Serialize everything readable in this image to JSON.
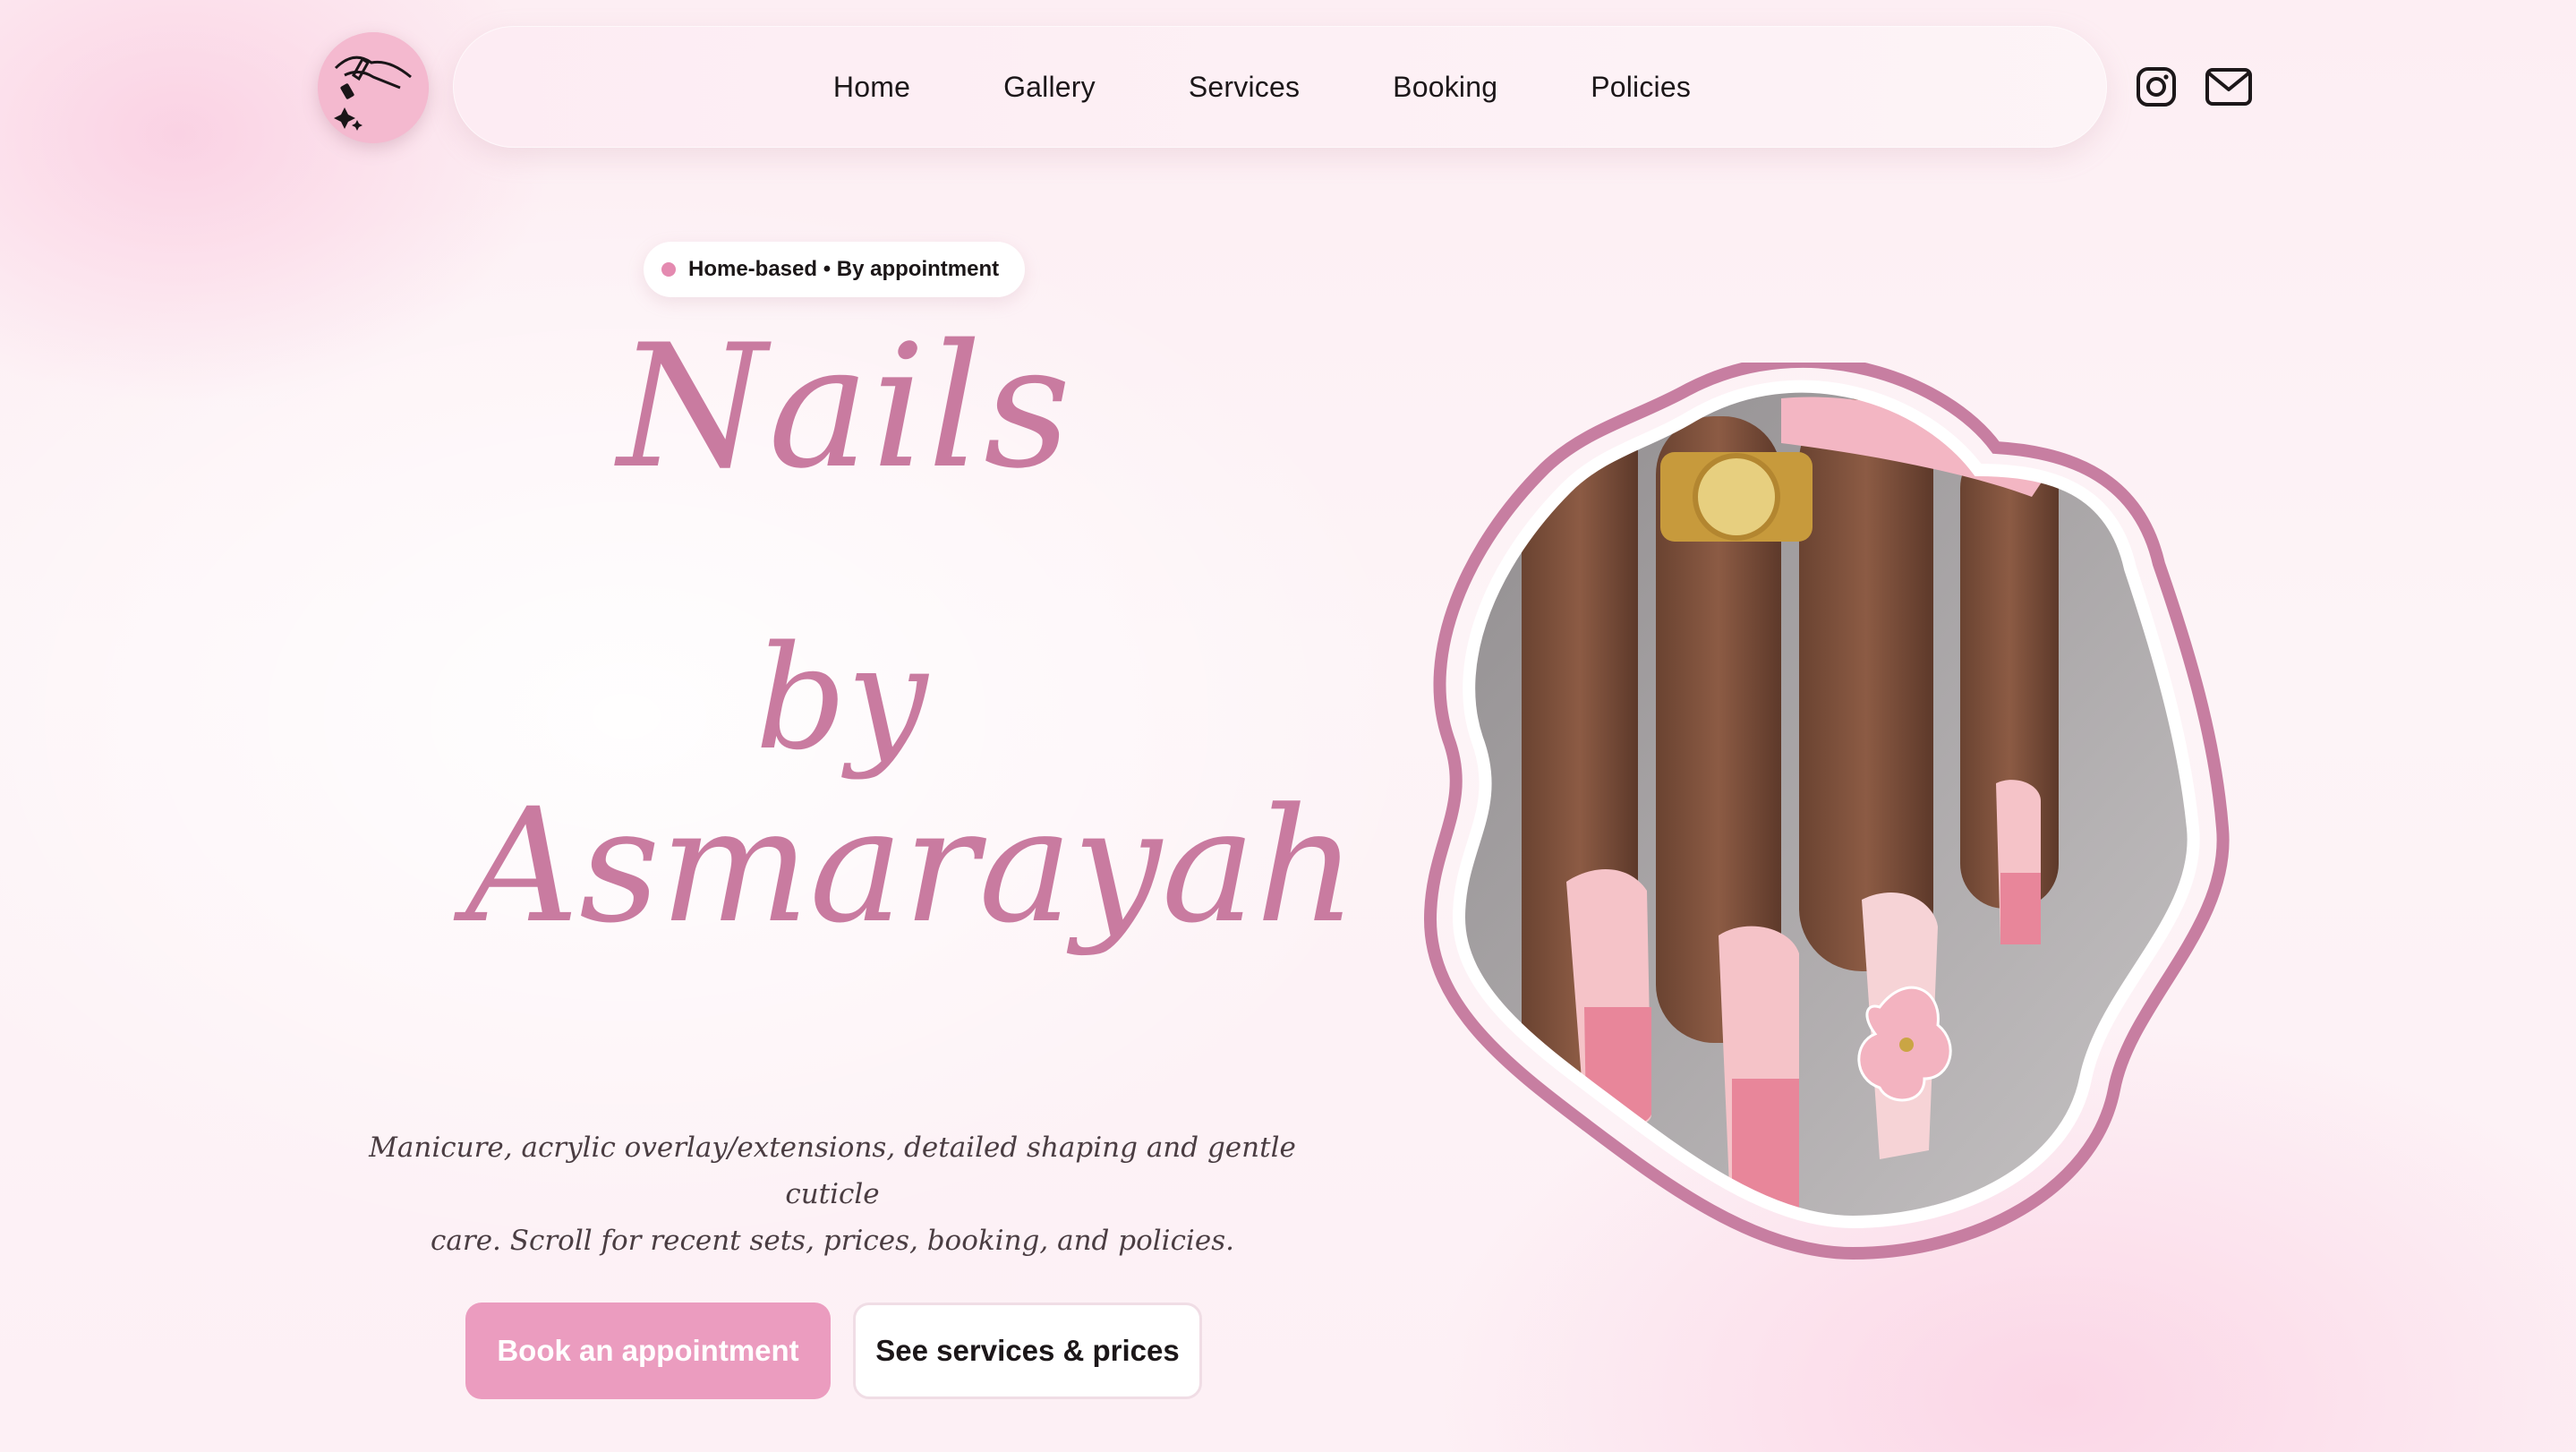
{
  "header": {
    "nav": [
      "Home",
      "Gallery",
      "Services",
      "Booking",
      "Policies"
    ],
    "logo_icon": "nail-polish-hand-icon",
    "social": {
      "instagram_icon": "instagram-icon",
      "mail_icon": "mail-icon"
    }
  },
  "hero": {
    "badge": "Home-based • By appointment",
    "title_line1": "Nails",
    "title_line2": "by",
    "title_line3": "Asmarayah",
    "tagline_line1": "Manicure, acrylic overlay/extensions, detailed shaping and gentle cuticle",
    "tagline_line2": "care. Scroll for recent sets, prices, booking, and policies.",
    "primary_button": "Book an appointment",
    "secondary_button": "See services & prices"
  },
  "colors": {
    "accent_pink": "#c97ba0",
    "button_pink": "#eb9cbf",
    "frame_pink": "#c77ea1",
    "background": "#fdf0f5"
  }
}
